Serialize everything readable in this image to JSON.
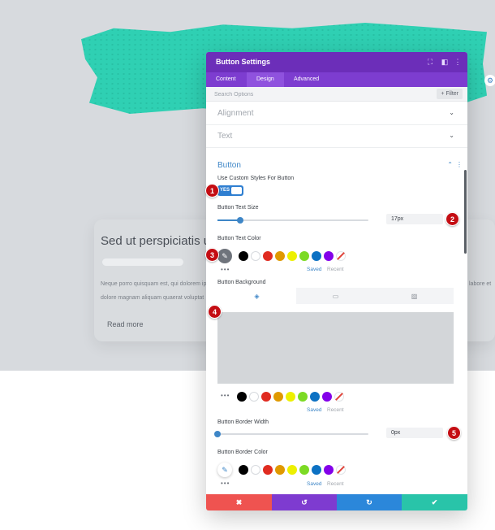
{
  "background": {
    "card": {
      "title": "Sed ut perspiciatis un",
      "text_line_1_left": "Neque porro quisquam est, qui dolorem ip",
      "text_line_1_right": "labore et",
      "text_line_2_left": "dolore magnam aliquam quaerat voluptat",
      "read_more": "Read more"
    }
  },
  "panel": {
    "title": "Button Settings",
    "header_icons": [
      "fullscreen-icon",
      "sidebar-icon",
      "kebab-icon"
    ],
    "tabs": [
      {
        "label": "Content"
      },
      {
        "label": "Design"
      },
      {
        "label": "Advanced"
      }
    ],
    "search_placeholder": "Search Options",
    "filter_label": "+ Filter",
    "sections": {
      "alignment": "Alignment",
      "text": "Text",
      "button": "Button"
    },
    "fields": {
      "custom_styles_label": "Use Custom Styles For Button",
      "toggle_value": "YES",
      "text_size_label": "Button Text Size",
      "text_size_value": "17px",
      "text_size_fraction": 0.15,
      "text_color_label": "Button Text Color",
      "background_label": "Button Background",
      "border_width_label": "Button Border Width",
      "border_width_value": "0px",
      "border_width_fraction": 0.0,
      "border_color_label": "Button Border Color"
    },
    "palette": [
      "#000000",
      "#ffffff",
      "#e02b20",
      "#e09900",
      "#edf000",
      "#7cda24",
      "#0c71c3",
      "#8300e9"
    ],
    "saved_label": "Saved",
    "recent_label": "Recent",
    "more_dots": "•••",
    "footer": {
      "cancel_icon": "✖",
      "undo_icon": "↺",
      "redo_icon": "↻",
      "save_icon": "✔",
      "colors": [
        "#ef5350",
        "#7e3bd0",
        "#2b87da",
        "#29c4a9"
      ]
    }
  },
  "markers": [
    "1",
    "2",
    "3",
    "4",
    "5"
  ]
}
